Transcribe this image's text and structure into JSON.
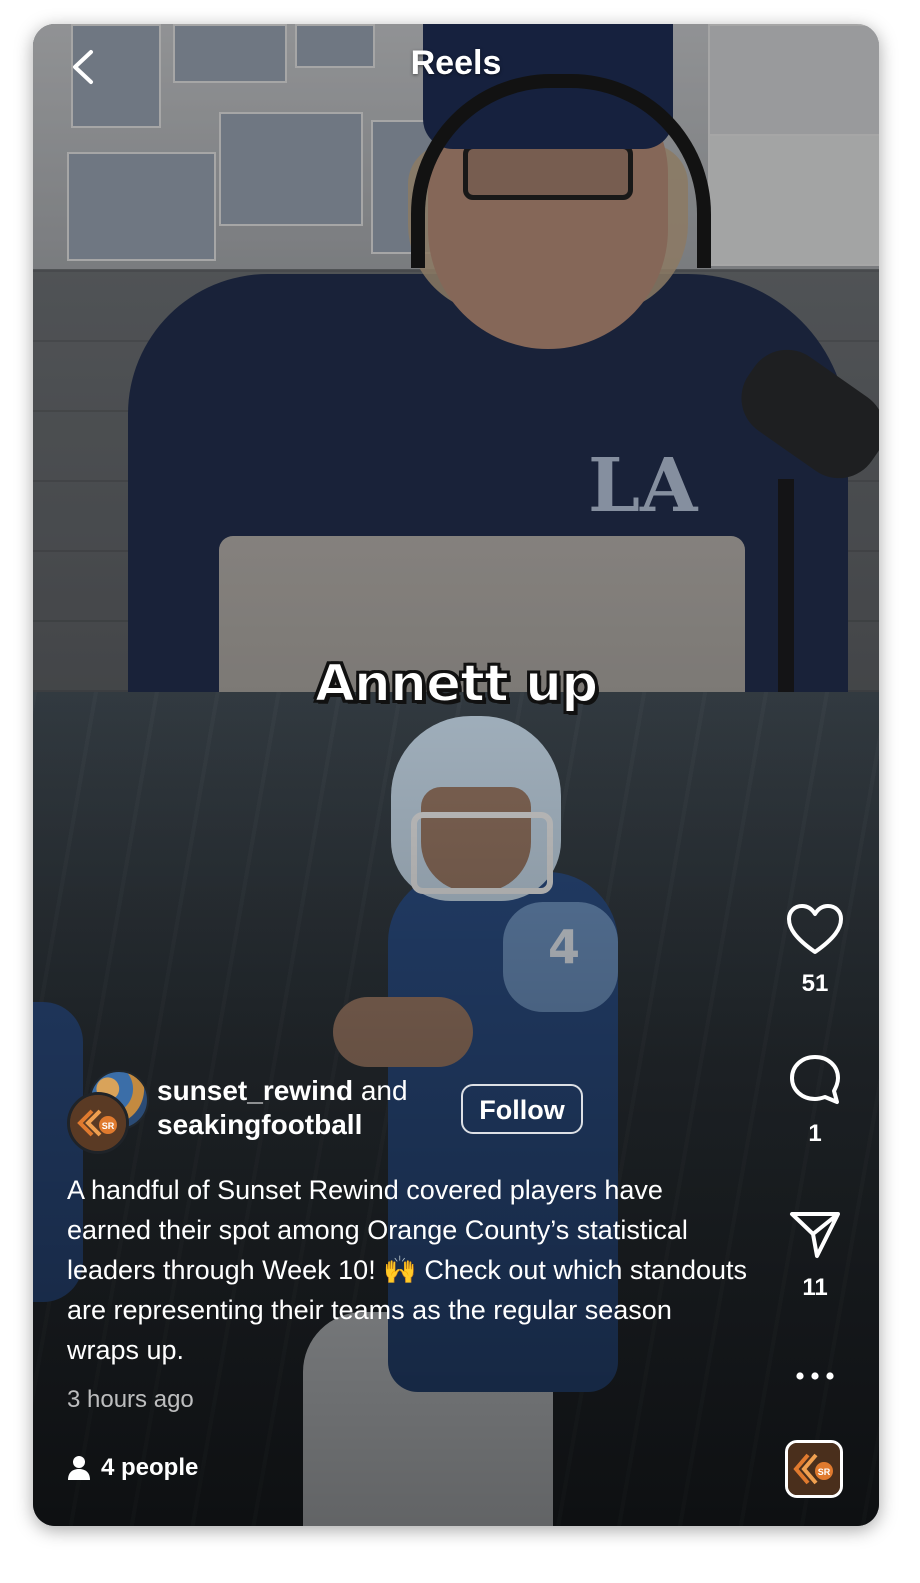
{
  "header": {
    "title": "Reels",
    "back_icon": "chevron-left-icon"
  },
  "video": {
    "overlay_caption": "Annett up"
  },
  "actions": {
    "like": {
      "icon": "heart-icon",
      "count": "51"
    },
    "comment": {
      "icon": "comment-bubble-icon",
      "count": "1"
    },
    "share": {
      "icon": "send-icon",
      "count": "11"
    },
    "more": {
      "icon": "more-horizontal-icon"
    },
    "audio": {
      "icon": "audio-thumbnail-icon"
    }
  },
  "author": {
    "primary": "sunset_rewind",
    "connector": "and",
    "secondary": "seakingfootball",
    "follow_label": "Follow"
  },
  "post": {
    "caption": "A handful of Sunset Rewind covered players have earned their spot among Orange County’s statistical leaders through Week 10! 🙌 Check out which standouts are representing their teams as the regular season wraps up.",
    "timestamp": "3 hours ago",
    "people_label": "4 people"
  },
  "colors": {
    "accent": "#e07a2e",
    "text": "#ffffff"
  }
}
